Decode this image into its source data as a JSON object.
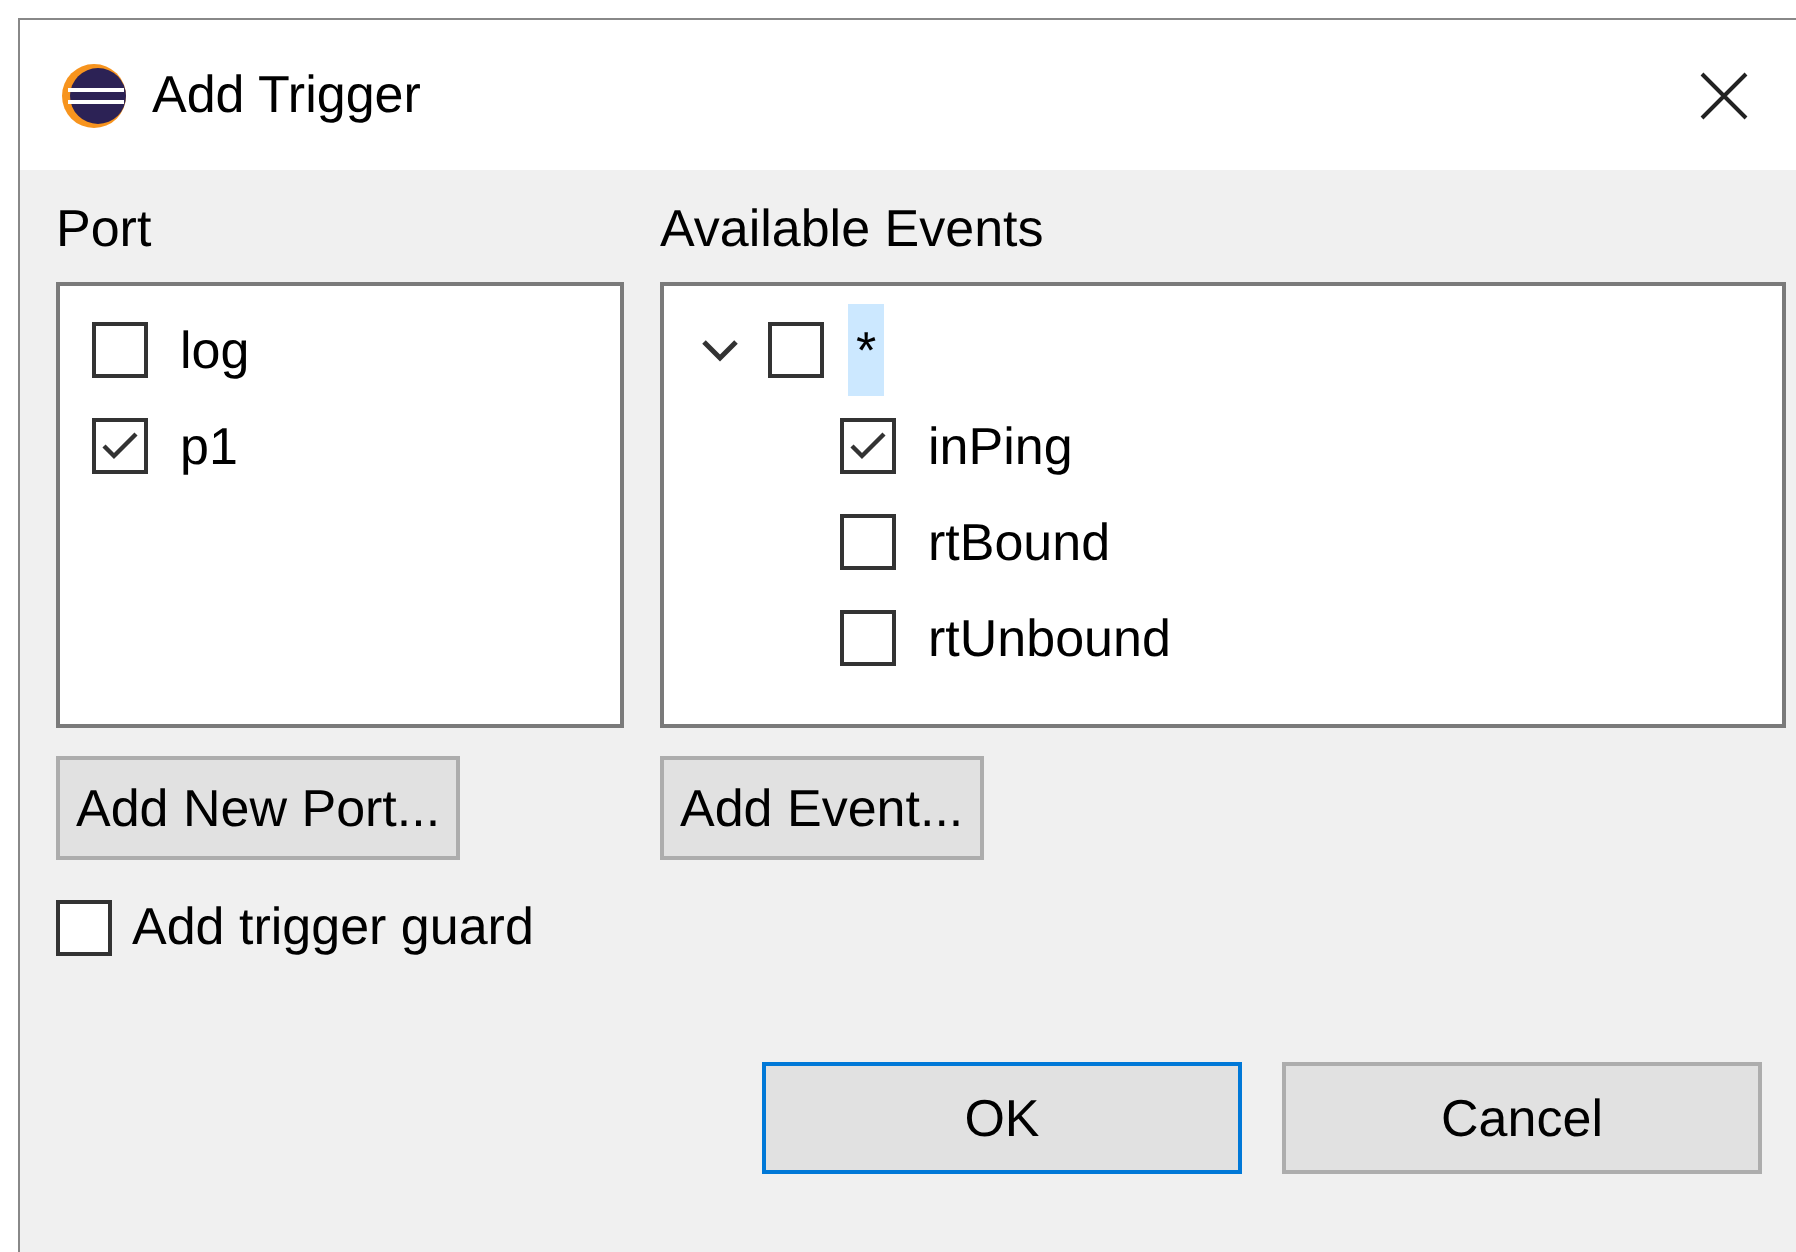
{
  "window": {
    "title": "Add Trigger"
  },
  "port": {
    "label": "Port",
    "items": [
      {
        "label": "log",
        "checked": false
      },
      {
        "label": "p1",
        "checked": true
      }
    ],
    "button": "Add New Port..."
  },
  "events": {
    "label": "Available Events",
    "items": [
      {
        "label": "*",
        "checked": false,
        "expanded": true,
        "selected": true,
        "children": [
          {
            "label": "inPing",
            "checked": true,
            "selected": false
          },
          {
            "label": "rtBound",
            "checked": false,
            "selected": false
          },
          {
            "label": "rtUnbound",
            "checked": false,
            "selected": false
          }
        ]
      }
    ],
    "button": "Add Event..."
  },
  "guard": {
    "label": "Add trigger guard",
    "checked": false
  },
  "buttons": [
    {
      "label": "OK",
      "default": true
    },
    {
      "label": "Cancel",
      "default": false
    }
  ]
}
